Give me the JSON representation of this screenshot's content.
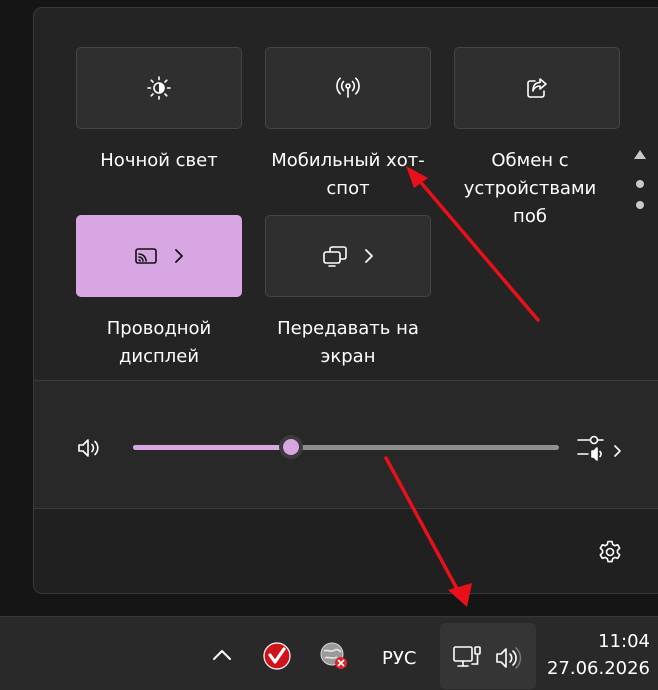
{
  "quick_settings": {
    "tiles": [
      {
        "id": "night-light",
        "label": "Ночной свет",
        "icon": "brightness-icon",
        "active": false
      },
      {
        "id": "mobile-hotspot",
        "label": "Мобильный хот-\nспот",
        "icon": "hotspot-icon",
        "active": false
      },
      {
        "id": "nearby-share",
        "label": "Обмен с\nустройствами поб",
        "icon": "share-icon",
        "active": false
      },
      {
        "id": "wired-display",
        "label": "Проводной\nдисплей",
        "icon": "cast-icon",
        "active": true,
        "has_chevron": true
      },
      {
        "id": "cast",
        "label": "Передавать на\nэкран",
        "icon": "project-icon",
        "active": false,
        "has_chevron": true
      }
    ],
    "volume": {
      "level_percent": 37,
      "icon": "speaker-icon",
      "mixer_icon": "sound-mixer-icon"
    },
    "settings_icon": "gear-icon",
    "accent_color": "#d9a6e4"
  },
  "taskbar": {
    "language": "РУС",
    "time": "11:04",
    "date": "27.06.2026",
    "tray_icons": [
      "chevron-up-icon",
      "antivirus-icon",
      "network-status-icon",
      "network-monitor-icon",
      "volume-icon"
    ]
  }
}
